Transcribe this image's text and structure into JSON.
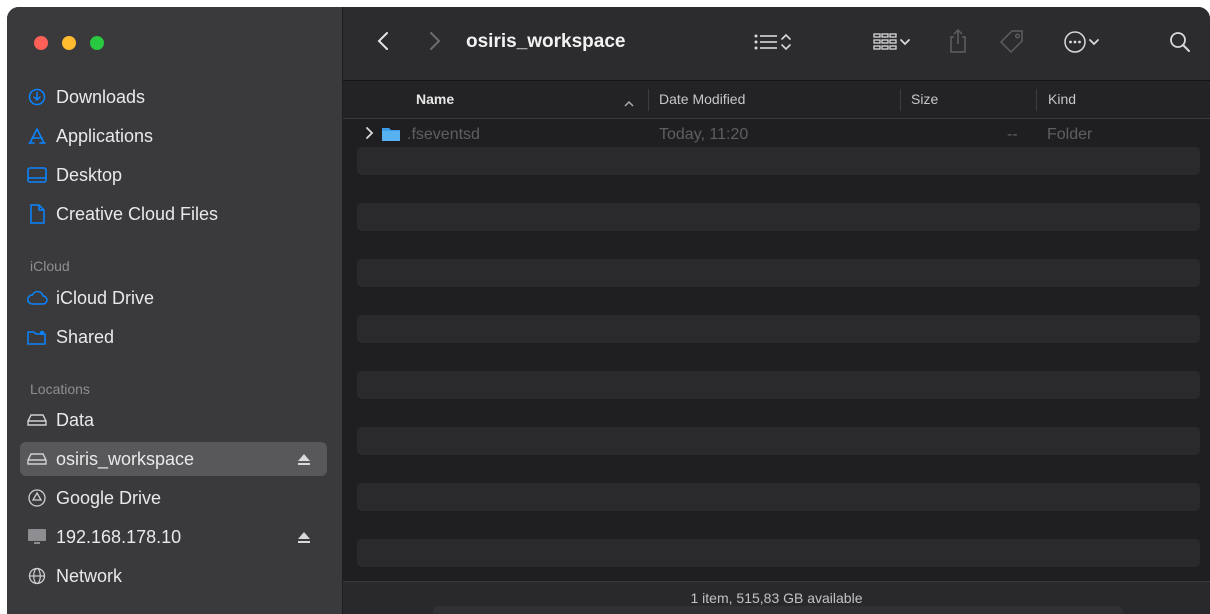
{
  "window": {
    "title": "osiris_workspace"
  },
  "sidebar": {
    "favorites": [
      {
        "label": "Downloads",
        "icon": "download-circle-icon"
      },
      {
        "label": "Applications",
        "icon": "applications-icon"
      },
      {
        "label": "Desktop",
        "icon": "desktop-icon"
      },
      {
        "label": "Creative Cloud Files",
        "icon": "document-icon"
      }
    ],
    "icloud_heading": "iCloud",
    "icloud": [
      {
        "label": "iCloud Drive",
        "icon": "cloud-icon"
      },
      {
        "label": "Shared",
        "icon": "shared-folder-icon"
      }
    ],
    "locations_heading": "Locations",
    "locations": [
      {
        "label": "Data",
        "icon": "drive-icon"
      },
      {
        "label": "osiris_workspace",
        "icon": "drive-icon",
        "selected": true
      },
      {
        "label": "Google Drive",
        "icon": "google-drive-icon"
      },
      {
        "label": "192.168.178.10",
        "icon": "monitor-icon"
      },
      {
        "label": "Network",
        "icon": "network-globe-icon"
      }
    ]
  },
  "columns": {
    "name": "Name",
    "date": "Date Modified",
    "size": "Size",
    "kind": "Kind"
  },
  "files": [
    {
      "name": ".fseventsd",
      "date": "Today, 11:20",
      "size": "--",
      "kind": "Folder"
    }
  ],
  "status": "1 item, 515,83 GB available",
  "colors": {
    "accent": "#0a84ff",
    "folder": "#3d9ce6",
    "selected": "#58585b"
  }
}
